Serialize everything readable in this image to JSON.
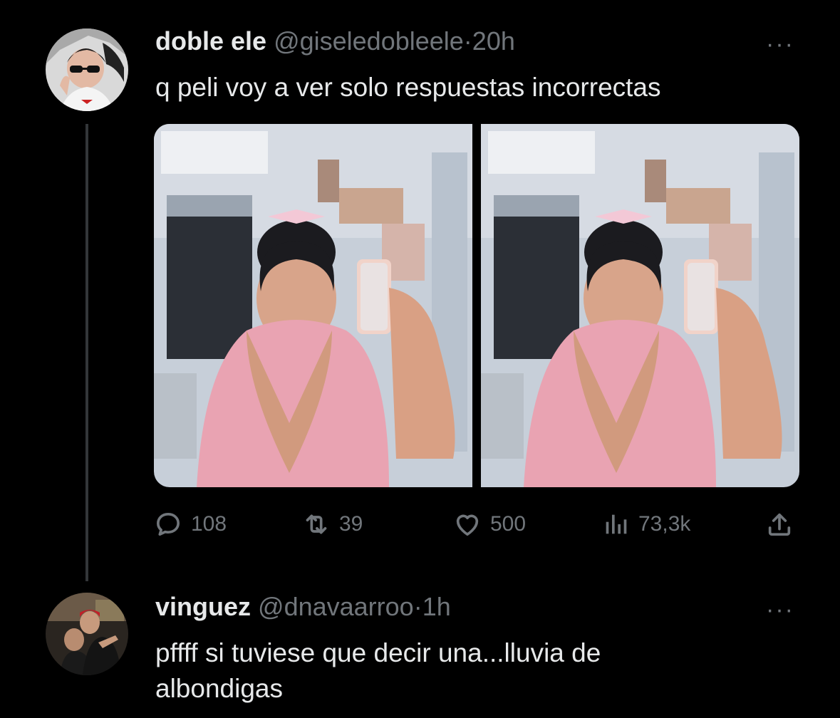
{
  "tweet1": {
    "display_name": "doble ele",
    "handle": "@giseledobleele",
    "separator": "·",
    "time": "20h",
    "more_label": "···",
    "text": "q peli voy a ver solo respuestas incorrectas",
    "stats": {
      "replies": "108",
      "retweets": "39",
      "likes": "500",
      "views": "73,3k"
    }
  },
  "tweet2": {
    "display_name": "vinguez",
    "handle": "@dnavaarroo",
    "separator": "·",
    "time": "1h",
    "more_label": "···",
    "text": "pffff si tuviese que decir una...lluvia de\nalbondigas"
  },
  "icons": {
    "reply": "reply-icon",
    "retweet": "retweet-icon",
    "like": "heart-icon",
    "views": "views-icon",
    "share": "share-icon",
    "more": "more-icon"
  },
  "colors": {
    "background": "#000000",
    "text_primary": "#e7e9ea",
    "text_secondary": "#71767b",
    "thread_line": "#333639"
  }
}
